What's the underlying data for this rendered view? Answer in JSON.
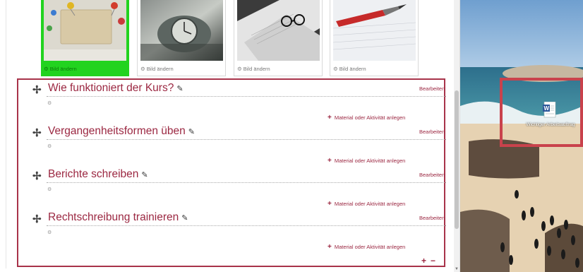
{
  "tiles": [
    {
      "caption": "Bild ändern",
      "selected": true
    },
    {
      "caption": "Bild ändern",
      "selected": false
    },
    {
      "caption": "Bild ändern",
      "selected": false
    },
    {
      "caption": "Bild ändern",
      "selected": false
    }
  ],
  "sections": [
    {
      "title": "Wie funktioniert der Kurs?",
      "edit_label": "Bearbeiten",
      "add_label": "Material oder Aktivität anlegen"
    },
    {
      "title": "Vergangenheitsformen üben",
      "edit_label": "Bearbeiten",
      "add_label": "Material oder Aktivität anlegen"
    },
    {
      "title": "Berichte schreiben",
      "edit_label": "Bearbeiten",
      "add_label": "Material oder Aktivität anlegen"
    },
    {
      "title": "Rechtschreibung trainieren",
      "edit_label": "Bearbeiten",
      "add_label": "Material oder Aktivität anlegen"
    }
  ],
  "bottom_controls": {
    "add": "+",
    "remove": "−"
  },
  "desktop": {
    "file_label": "Wichtiger Arbeitsauftrag",
    "icon": "word-document-icon"
  },
  "colors": {
    "accent": "#9b2741",
    "selected_tile": "#22d31f",
    "highlight_frame": "#c9424c"
  }
}
